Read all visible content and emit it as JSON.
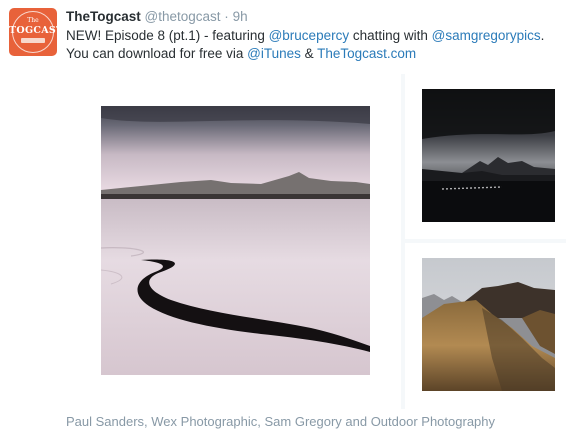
{
  "tweet": {
    "author_name": "TheTogcast",
    "author_handle": "@thetogcast",
    "separator": "·",
    "time": "9h",
    "text_parts": {
      "p1": "NEW! Episode 8 (pt.1) - featuring ",
      "mention1": "@brucepercy",
      "p2": " chatting with ",
      "mention2": "@samgregorypics",
      "p3": ".",
      "p4": "You can download for free via ",
      "mention3": "@iTunes",
      "p5": " & ",
      "link": "TheTogcast.com"
    },
    "avatar": {
      "small_text": "The",
      "brand_text": "TOGCAST",
      "color": "#e8623a"
    },
    "media": {
      "images": [
        {
          "name": "lake-shoreline-photo"
        },
        {
          "name": "dark-mountains-lake-photo"
        },
        {
          "name": "golden-hills-photo"
        }
      ]
    },
    "caption": "Paul Sanders, Wex Photographic, Sam Gregory and Outdoor Photography"
  },
  "colors": {
    "name_text": "#292f33",
    "meta_text": "#8899a6",
    "link": "#2b7bb9",
    "media_gap": "#f5f8fa"
  }
}
